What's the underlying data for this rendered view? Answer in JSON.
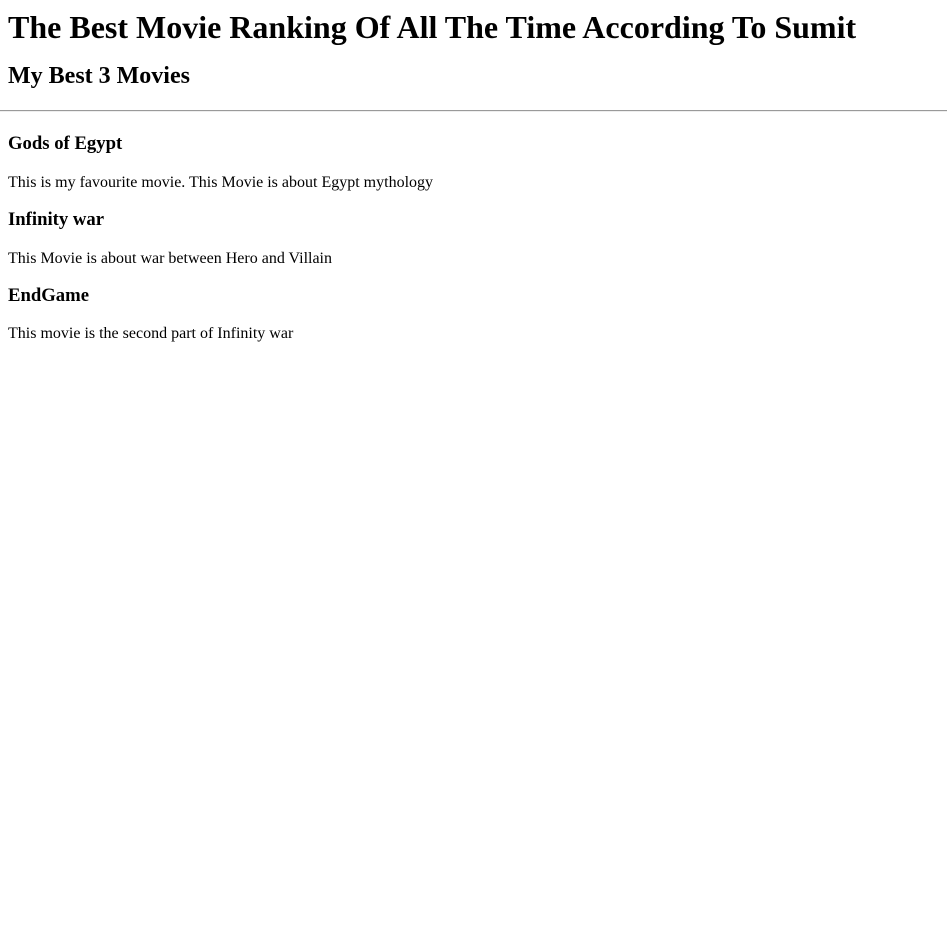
{
  "page": {
    "title": "The Best Movie Ranking Of All The Time According To Sumit",
    "subtitle": "My Best 3 Movies"
  },
  "movies": [
    {
      "title": "Gods of Egypt",
      "description": "This is my favourite movie. This Movie is about Egypt mythology"
    },
    {
      "title": "Infinity war",
      "description": "This Movie is about war between Hero and Villain"
    },
    {
      "title": "EndGame",
      "description": "This movie is the second part of Infinity war"
    }
  ]
}
